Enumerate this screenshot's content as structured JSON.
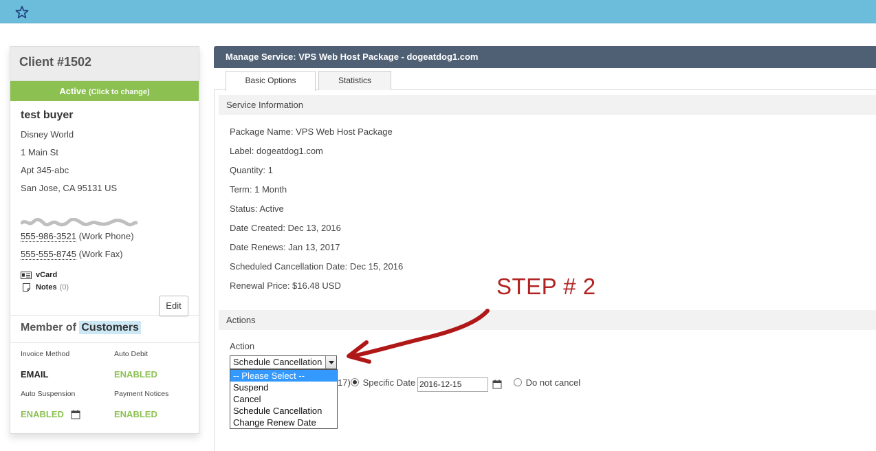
{
  "client": {
    "title": "Client #1502",
    "status": "Active",
    "status_hint": "(Click to change)",
    "name": "test buyer",
    "address": [
      "Disney World",
      "1 Main St",
      "Apt 345-abc",
      "San Jose, CA 95131 US"
    ],
    "phones": [
      {
        "number": "555-986-3521",
        "type": "(Work Phone)"
      },
      {
        "number": "555-555-8745",
        "type": "(Work Fax)"
      }
    ],
    "vcard_label": "vCard",
    "notes_label": "Notes",
    "notes_count": "(0)",
    "edit_label": "Edit",
    "member_prefix": "Member of",
    "member_group": "Customers",
    "props": {
      "invoice_method_label": "Invoice Method",
      "invoice_method_value": "EMAIL",
      "auto_debit_label": "Auto Debit",
      "auto_debit_value": "ENABLED",
      "auto_suspension_label": "Auto Suspension",
      "auto_suspension_value": "ENABLED",
      "payment_notices_label": "Payment Notices",
      "payment_notices_value": "ENABLED"
    }
  },
  "manage": {
    "title": "Manage Service: VPS Web Host Package - dogeatdog1.com",
    "tabs": [
      "Basic Options",
      "Statistics"
    ],
    "service_info_heading": "Service Information",
    "info": [
      "Package Name: VPS Web Host Package",
      "Label: dogeatdog1.com",
      "Quantity: 1",
      "Term: 1 Month",
      "Status: Active",
      "Date Created: Dec 13, 2016",
      "Date Renews: Jan 13, 2017",
      "Scheduled Cancellation Date: Dec 15, 2016",
      "Renewal Price: $16.48 USD"
    ],
    "actions_heading": "Actions",
    "action_label": "Action",
    "action_selected": "Schedule Cancellation",
    "action_options": [
      "-- Please Select --",
      "Suspend",
      "Cancel",
      "Schedule Cancellation",
      "Change Renew Date"
    ],
    "partial_text": "17)",
    "specific_date_label": "Specific Date",
    "specific_date_value": "2016-12-15",
    "do_not_cancel_label": "Do not cancel"
  },
  "annotation": {
    "step_text": "STEP # 2",
    "color": "#b22222"
  },
  "colors": {
    "topbar": "#6cbcdc",
    "active_green": "#8cc152",
    "header_dark": "#4f6075",
    "dropdown_highlight": "#3399ff"
  }
}
